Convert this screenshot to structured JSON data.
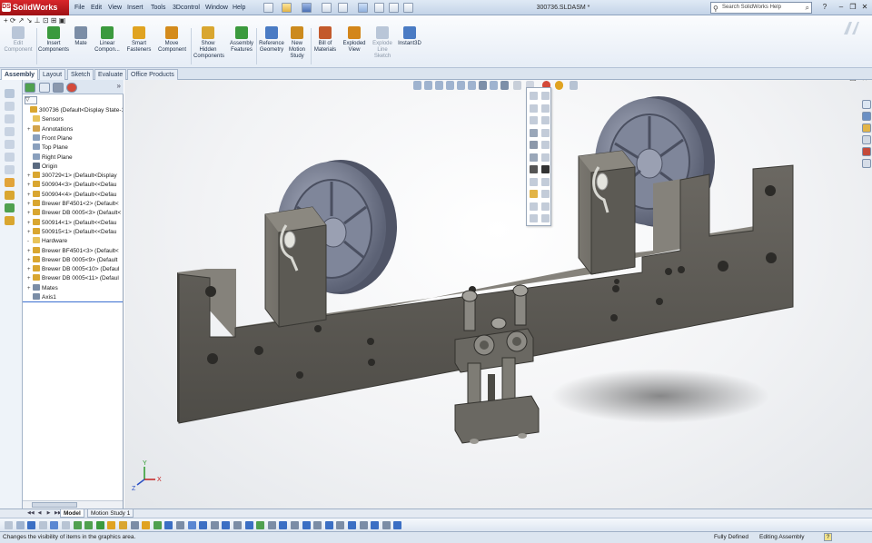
{
  "app": {
    "name": "SolidWorks",
    "logo_text": "DS",
    "document_title": "300736.SLDASM *"
  },
  "menu": [
    "File",
    "Edit",
    "View",
    "Insert",
    "Tools",
    "3Dcontrol",
    "Window",
    "Help"
  ],
  "search": {
    "placeholder": "Search SolidWorks Help"
  },
  "window_controls": {
    "help": "?",
    "minimize": "–",
    "restore": "❐",
    "close": "✕"
  },
  "commands": [
    {
      "label": "Edit Component",
      "enabled": false,
      "color": "#b9c6d8"
    },
    {
      "label": "Insert Components",
      "enabled": true,
      "color": "#3b9a3e"
    },
    {
      "label": "Mate",
      "enabled": true,
      "color": "#7b8da6"
    },
    {
      "label": "Linear Compon...",
      "enabled": true,
      "color": "#3b9a3e"
    },
    {
      "label": "Smart Fasteners",
      "enabled": true,
      "color": "#e0a321"
    },
    {
      "label": "Move Component",
      "enabled": true,
      "color": "#d48b1c"
    },
    {
      "label": "Show Hidden Components",
      "enabled": true,
      "color": "#d9a630"
    },
    {
      "label": "Assembly Features",
      "enabled": true,
      "color": "#3b9a3e"
    },
    {
      "label": "Reference Geometry",
      "enabled": true,
      "color": "#4a7bc4"
    },
    {
      "label": "New Motion Study",
      "enabled": true,
      "color": "#cc8a1d"
    },
    {
      "label": "Bill of Materials",
      "enabled": true,
      "color": "#c35a2c"
    },
    {
      "label": "Exploded View",
      "enabled": true,
      "color": "#d3861a"
    },
    {
      "label": "Explode Line Sketch",
      "enabled": false,
      "color": "#b9c6d8"
    },
    {
      "label": "Instant3D",
      "enabled": true,
      "color": "#4a7bc4"
    }
  ],
  "tabs": [
    "Assembly",
    "Layout",
    "Sketch",
    "Evaluate",
    "Office Products"
  ],
  "tree": {
    "filter": "▽",
    "items": [
      {
        "label": "300736  (Default<Display State-1",
        "indent": 0,
        "expander": "",
        "color": "#d9a630"
      },
      {
        "label": "Sensors",
        "indent": 1,
        "expander": "",
        "color": "#e8c35a"
      },
      {
        "label": "Annotations",
        "indent": 1,
        "expander": "+",
        "color": "#d3a34a"
      },
      {
        "label": "Front Plane",
        "indent": 1,
        "expander": "",
        "color": "#8aa0bd"
      },
      {
        "label": "Top Plane",
        "indent": 1,
        "expander": "",
        "color": "#8aa0bd"
      },
      {
        "label": "Right Plane",
        "indent": 1,
        "expander": "",
        "color": "#8aa0bd"
      },
      {
        "label": "Origin",
        "indent": 1,
        "expander": "",
        "color": "#5a6a80"
      },
      {
        "label": "300729<1> (Default<Display",
        "indent": 1,
        "expander": "+",
        "color": "#d9a630"
      },
      {
        "label": "500904<3> (Default<<Defau",
        "indent": 1,
        "expander": "+",
        "color": "#d9a630"
      },
      {
        "label": "500904<4> (Default<<Defau",
        "indent": 1,
        "expander": "+",
        "color": "#d9a630"
      },
      {
        "label": "Brewer BF4501<2> (Default<",
        "indent": 1,
        "expander": "+",
        "color": "#d9a630"
      },
      {
        "label": "Brewer DB 0005<3> (Default<",
        "indent": 1,
        "expander": "+",
        "color": "#d9a630"
      },
      {
        "label": "500914<1> (Default<<Defau",
        "indent": 1,
        "expander": "+",
        "color": "#d9a630"
      },
      {
        "label": "500915<1> (Default<<Defau",
        "indent": 1,
        "expander": "+",
        "color": "#d9a630"
      },
      {
        "label": "Hardware",
        "indent": 1,
        "expander": "-",
        "color": "#e8c35a"
      },
      {
        "label": "Brewer BF4501<3> (Default<",
        "indent": 1,
        "expander": "+",
        "color": "#d9a630"
      },
      {
        "label": "Brewer DB 0005<9> (Default",
        "indent": 1,
        "expander": "+",
        "color": "#d9a630"
      },
      {
        "label": "Brewer DB 0005<10> (Defaul",
        "indent": 1,
        "expander": "+",
        "color": "#d9a630"
      },
      {
        "label": "Brewer DB 0005<11> (Defaul",
        "indent": 1,
        "expander": "+",
        "color": "#d9a630"
      },
      {
        "label": "Mates",
        "indent": 1,
        "expander": "+",
        "color": "#7b8da6"
      },
      {
        "label": "Axis1",
        "indent": 1,
        "expander": "",
        "color": "#7b8da6"
      }
    ]
  },
  "viewport": {
    "triad_axes": [
      "Y",
      "X",
      "Z"
    ],
    "close_glyph": "✕"
  },
  "model_tabs": [
    "Model",
    "Motion Study 1"
  ],
  "status": {
    "message": "Changes the visibility of items in the graphics area.",
    "state": "Fully Defined",
    "mode": "Editing Assembly",
    "help": "?"
  },
  "colors": {
    "accent": "#c4161c",
    "model_gray": "#5c5a54",
    "model_dark": "#3e3d39",
    "wheel": "#7a8196"
  }
}
